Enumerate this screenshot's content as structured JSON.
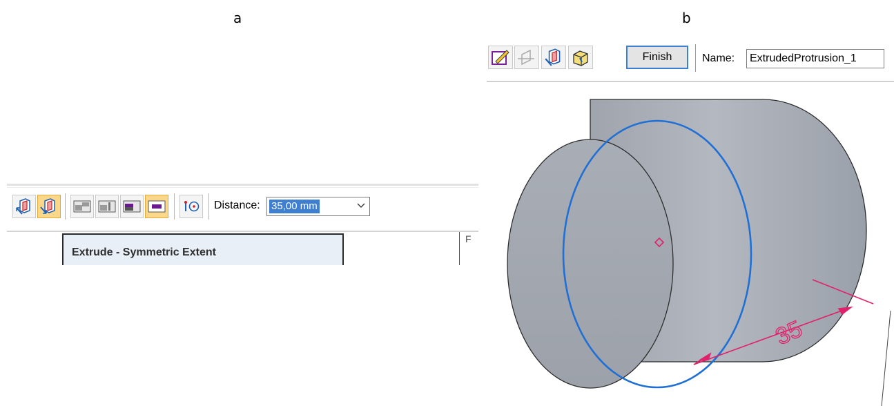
{
  "labels": {
    "a": "a",
    "b": "b"
  },
  "panel_a": {
    "toolbar_icons": [
      "extrude-side-icon",
      "extrude-symmetric-icon",
      "extent-finite-icon",
      "extent-through-next-icon",
      "extent-from-to-icon",
      "extent-symmetric-icon",
      "keypoint-icon"
    ],
    "distance_label": "Distance:",
    "distance_value": "35,00 mm",
    "tooltip_title": "Extrude - Symmetric Extent",
    "colors": {
      "active_button": "#fbd889",
      "selection": "#3f7fd1"
    }
  },
  "panel_b": {
    "toolbar_icons": [
      "sketch-icon",
      "plane-icon",
      "extrude-side-icon",
      "treatment-icon"
    ],
    "finish_label": "Finish",
    "name_label": "Name:",
    "name_value": "ExtrudedProtrusion_1",
    "dimension_value": "35",
    "colors": {
      "profile": "#1f6fd4",
      "dimension": "#e0226a",
      "body": "#a6abb4"
    }
  }
}
